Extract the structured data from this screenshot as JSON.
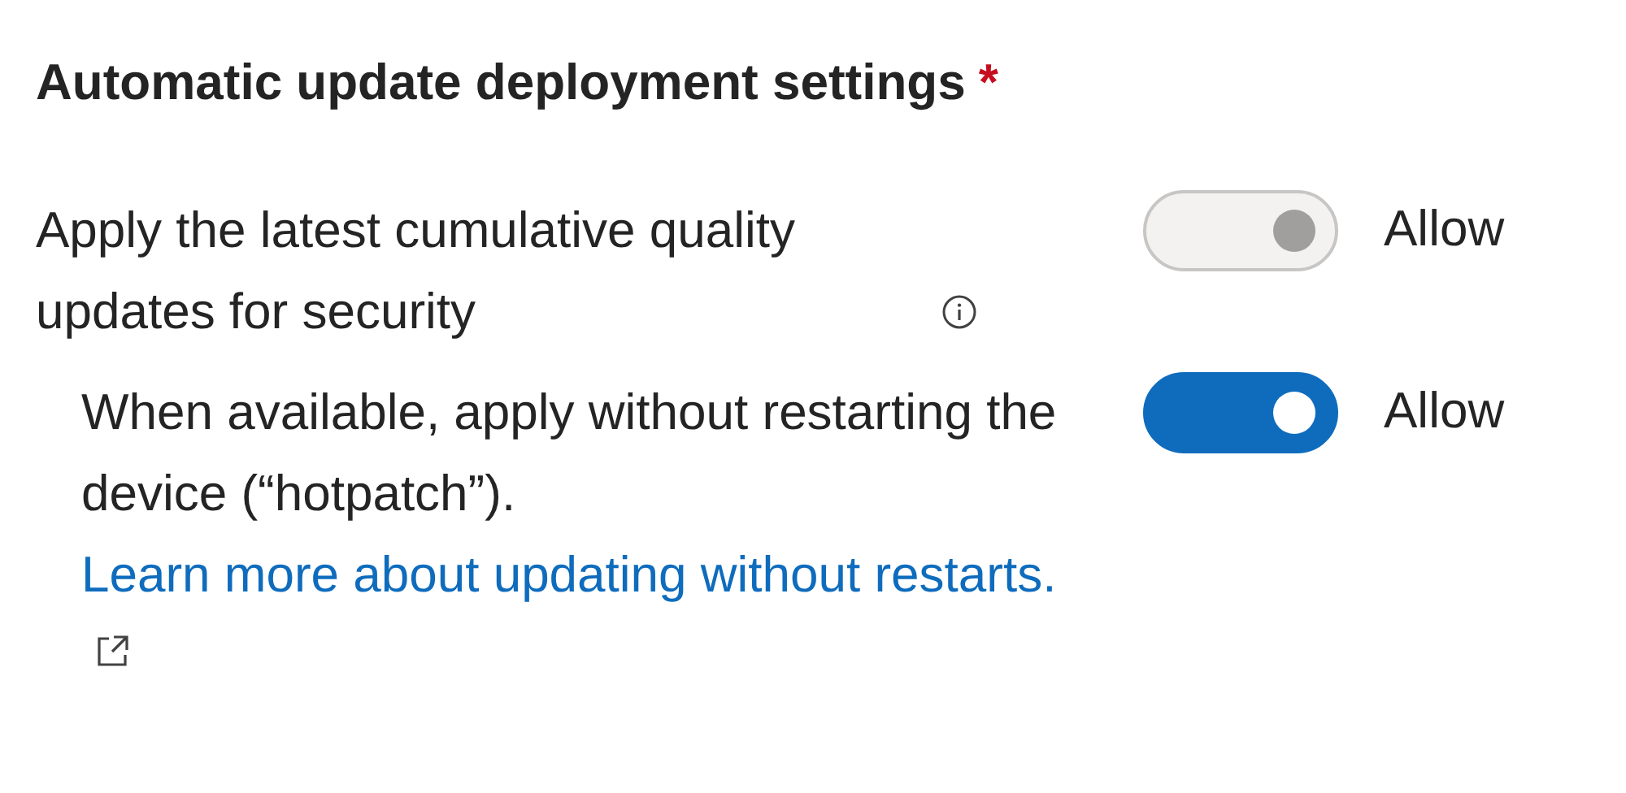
{
  "title": "Automatic update deployment settings",
  "required_mark": "*",
  "settings": [
    {
      "label": "Apply the latest cumulative quality updates for security",
      "has_info": true,
      "on": true,
      "disabled": true,
      "state_label": "Allow",
      "indented": false
    },
    {
      "label": "When available, apply without restarting the device (“hotpatch”).",
      "link": "Learn more about updating without restarts.",
      "has_info": false,
      "on": true,
      "disabled": false,
      "state_label": "Allow",
      "indented": true
    }
  ]
}
